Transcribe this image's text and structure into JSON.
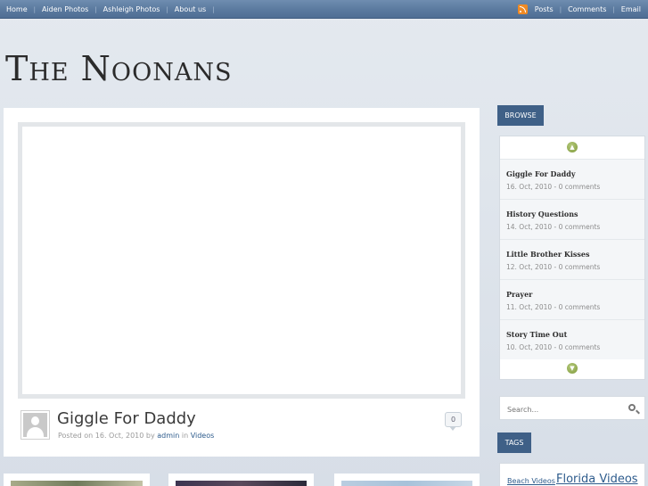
{
  "nav": {
    "left": [
      "Home",
      "Aiden Photos",
      "Ashleigh Photos",
      "About us"
    ],
    "right": [
      "Posts",
      "Comments",
      "Email"
    ]
  },
  "site": {
    "title": "The Noonans"
  },
  "post": {
    "title": "Giggle For Daddy",
    "posted_prefix": "Posted on 16. Oct, 2010 by ",
    "author": "admin",
    "in_word": " in ",
    "category": "Videos",
    "comment_count": "0"
  },
  "sidebar": {
    "browse_label": "BROWSE",
    "items": [
      {
        "title": "Giggle For Daddy",
        "date": "16. Oct, 2010 - 0 comments"
      },
      {
        "title": "History Questions",
        "date": "14. Oct, 2010 - 0 comments"
      },
      {
        "title": "Little Brother Kisses",
        "date": "12. Oct, 2010 - 0 comments"
      },
      {
        "title": "Prayer",
        "date": "11. Oct, 2010 - 0 comments"
      },
      {
        "title": "Story Time Out",
        "date": "10. Oct, 2010 - 0 comments"
      }
    ],
    "search_placeholder": "Search...",
    "tags_label": "TAGS",
    "tags": [
      "Beach Videos",
      "Florida Videos"
    ]
  },
  "colors": {
    "nav_bar": "#5c7ba0",
    "tab_blue": "#3f6087",
    "link": "#2d5b8c",
    "rss": "#f08a24",
    "arrow_green": "#8aa64a"
  }
}
